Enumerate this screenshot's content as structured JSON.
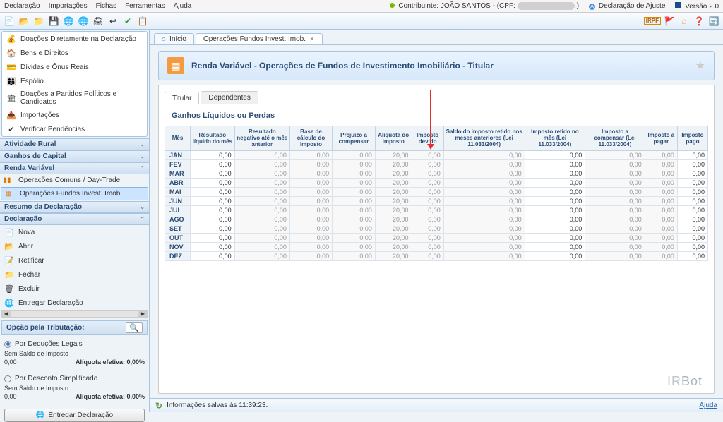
{
  "menu": {
    "m0": "Declaração",
    "m1": "Importações",
    "m2": "Fichas",
    "m3": "Ferramentas",
    "m4": "Ajuda"
  },
  "topright": {
    "contrib_label": "Contribuinte:",
    "contrib_name": "JOÃO SANTOS",
    "cpf_label": "- (CPF:",
    "cpf_mask": "XXXXXXXXXXX",
    "cpf_close": ")",
    "ajuste": "Declaração de Ajuste",
    "versao": "Versão 2.0",
    "irpf": "IRPF"
  },
  "sidebar": {
    "fichas": [
      {
        "icon": "💰",
        "label": "Doações Diretamente na Declaração"
      },
      {
        "icon": "🏠",
        "label": "Bens e Direitos"
      },
      {
        "icon": "💳",
        "label": "Dívidas e Ônus Reais"
      },
      {
        "icon": "👨‍👩‍👦",
        "label": "Espólio"
      },
      {
        "icon": "🏛",
        "label": "Doações a Partidos Políticos e Candidatos"
      },
      {
        "icon": "📥",
        "label": "Importações"
      },
      {
        "icon": "✔",
        "label": "Verificar Pendências"
      }
    ],
    "sections": {
      "rural": "Atividade Rural",
      "ganhos": "Ganhos de Capital",
      "renda": "Renda Variável",
      "resumo": "Resumo da Declaração",
      "decl": "Declaração"
    },
    "renda_sub": [
      {
        "icon": "📊",
        "label": "Operações Comuns / Day-Trade"
      },
      {
        "icon": "🏗",
        "label": "Operações Fundos Invest. Imob."
      }
    ],
    "decl_sub": [
      {
        "icon": "📄",
        "label": "Nova"
      },
      {
        "icon": "📂",
        "label": "Abrir"
      },
      {
        "icon": "📝",
        "label": "Retificar"
      },
      {
        "icon": "📁",
        "label": "Fechar"
      },
      {
        "icon": "🗑",
        "label": "Excluir"
      },
      {
        "icon": "🌐",
        "label": "Entregar Declaração"
      }
    ],
    "tax_title": "Opção pela Tributação:",
    "opt1": "Por Deduções Legais",
    "opt2": "Por Desconto Simplificado",
    "sem_saldo": "Sem Saldo de Imposto",
    "valor_zero": "0,00",
    "aliq": "Alíquota efetiva: 0,00%",
    "entregar": "Entregar Declaração"
  },
  "tabs": {
    "home": "Início",
    "t1": "Operações Fundos Invest. Imob."
  },
  "page": {
    "title": "Renda Variável - Operações de Fundos de Investimento Imobiliário - Titular",
    "tab_titular": "Titular",
    "tab_dep": "Dependentes",
    "section": "Ganhos Líquidos ou Perdas"
  },
  "cols": {
    "mes": "Mês",
    "c1": "Resultado líquido do mês",
    "c2": "Resultado negativo até o mês anterior",
    "c3": "Base de cálculo do imposto",
    "c4": "Prejuízo a compensar",
    "c5": "Alíquota do imposto",
    "c6": "Imposto devido",
    "c7": "Saldo do imposto retido nos meses anteriores (Lei 11.033/2004)",
    "c8": "Imposto retido no mês (Lei 11.033/2004)",
    "c9": "Imposto a compensar (Lei 11.033/2004)",
    "c10": "Imposto a pagar",
    "c11": "Imposto pago"
  },
  "months": [
    "JAN",
    "FEV",
    "MAR",
    "ABR",
    "MAI",
    "JUN",
    "JUL",
    "AGO",
    "SET",
    "OUT",
    "NOV",
    "DEZ"
  ],
  "zero": "0,00",
  "twenty": "20,00",
  "brand1": "IR",
  "brand2": "Bot",
  "status": {
    "msg": "Informações salvas às 11:39:23.",
    "help": "Ajuda"
  }
}
